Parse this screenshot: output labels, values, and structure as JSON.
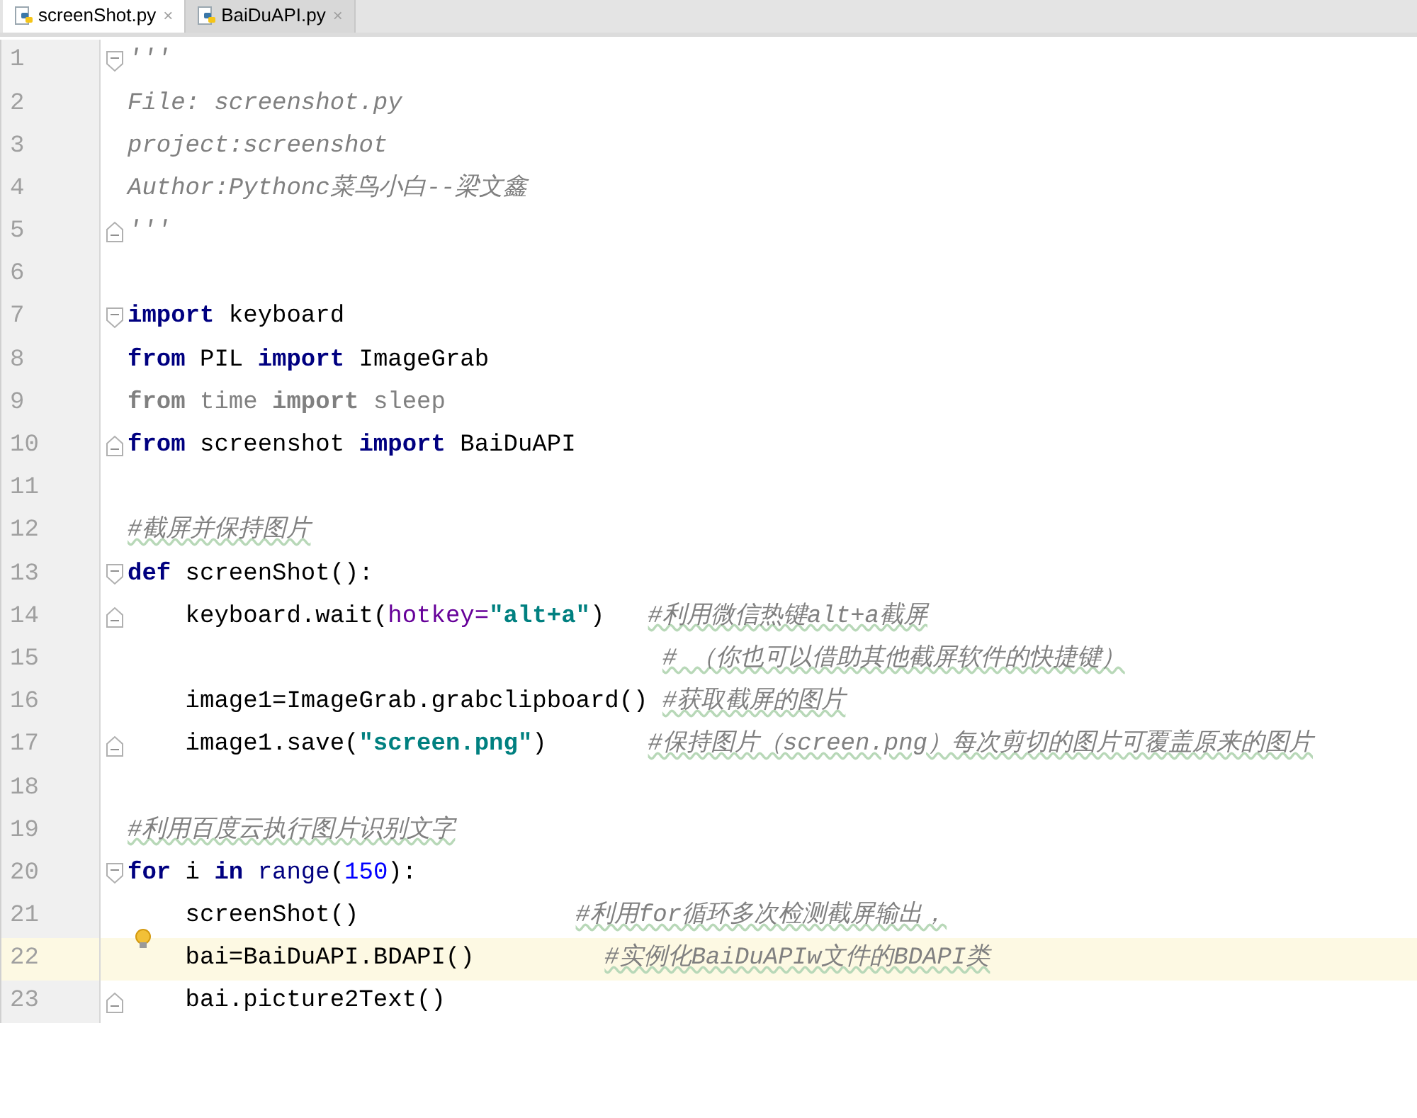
{
  "tabs": [
    {
      "label": "screenShot.py",
      "close": "×",
      "selected": true
    },
    {
      "label": "BaiDuAPI.py",
      "close": "×",
      "selected": false
    }
  ],
  "lines": [
    {
      "number": "1",
      "fold_start": true,
      "fold_end": false,
      "current": false,
      "tokens": [
        {
          "kind": "docstring",
          "text": "'''"
        }
      ]
    },
    {
      "number": "2",
      "fold_start": false,
      "fold_end": false,
      "current": false,
      "tokens": [
        {
          "kind": "docstring",
          "text": "File: screenshot.py"
        }
      ]
    },
    {
      "number": "3",
      "fold_start": false,
      "fold_end": false,
      "current": false,
      "tokens": [
        {
          "kind": "docstring",
          "text": "project:screenshot"
        }
      ]
    },
    {
      "number": "4",
      "fold_start": false,
      "fold_end": false,
      "current": false,
      "tokens": [
        {
          "kind": "docstring",
          "text": "Author:Pythonc菜鸟小白--梁文鑫"
        }
      ]
    },
    {
      "number": "5",
      "fold_start": false,
      "fold_end": true,
      "current": false,
      "tokens": [
        {
          "kind": "docstring",
          "text": "'''"
        }
      ]
    },
    {
      "number": "6",
      "fold_start": false,
      "fold_end": false,
      "current": false
    },
    {
      "number": "7",
      "fold_start": true,
      "fold_end": false,
      "current": false,
      "tokens": [
        {
          "kind": "keyword",
          "text": "import"
        },
        {
          "kind": "plain",
          "text": " keyboard"
        }
      ]
    },
    {
      "number": "8",
      "fold_start": false,
      "fold_end": false,
      "current": false,
      "tokens": [
        {
          "kind": "keyword",
          "text": "from"
        },
        {
          "kind": "plain",
          "text": " PIL "
        },
        {
          "kind": "keyword",
          "text": "import"
        },
        {
          "kind": "plain",
          "text": " ImageGrab"
        }
      ]
    },
    {
      "number": "9",
      "fold_start": false,
      "fold_end": false,
      "current": false,
      "tokens": [
        {
          "kind": "unused_keyword",
          "text": "from"
        },
        {
          "kind": "unused",
          "text": " time "
        },
        {
          "kind": "unused_keyword",
          "text": "import"
        },
        {
          "kind": "unused",
          "text": " sleep"
        }
      ]
    },
    {
      "number": "10",
      "fold_start": false,
      "fold_end": true,
      "current": false,
      "tokens": [
        {
          "kind": "keyword",
          "text": "from"
        },
        {
          "kind": "plain",
          "text": " screenshot "
        },
        {
          "kind": "keyword",
          "text": "import"
        },
        {
          "kind": "plain",
          "text": " BaiDuAPI"
        }
      ]
    },
    {
      "number": "11",
      "fold_start": false,
      "fold_end": false,
      "current": false
    },
    {
      "number": "12",
      "fold_start": false,
      "fold_end": false,
      "current": false,
      "tokens": [
        {
          "kind": "comment",
          "text": "#截屏并保持图片"
        }
      ]
    },
    {
      "number": "13",
      "fold_start": true,
      "fold_end": false,
      "current": false,
      "tokens": [
        {
          "kind": "keyword",
          "text": "def"
        },
        {
          "kind": "plain",
          "text": " screenShot():"
        }
      ]
    },
    {
      "number": "14",
      "fold_start": false,
      "fold_end": true,
      "current": false,
      "tokens": [
        {
          "kind": "plain",
          "text": "    keyboard.wait("
        },
        {
          "kind": "param",
          "text": "hotkey="
        },
        {
          "kind": "string",
          "text": "\"alt+a\""
        },
        {
          "kind": "plain",
          "text": ")   "
        },
        {
          "kind": "comment",
          "text": "#利用微信热键alt+a截屏"
        }
      ]
    },
    {
      "number": "15",
      "fold_start": false,
      "fold_end": false,
      "current": false,
      "tokens": [
        {
          "kind": "continued_comment",
          "text": "# （你也可以借助其他截屏软件的快捷键）"
        }
      ]
    },
    {
      "number": "16",
      "fold_start": false,
      "fold_end": false,
      "current": false,
      "tokens": [
        {
          "kind": "plain",
          "text": "    image1=ImageGrab.grabclipboard() "
        },
        {
          "kind": "comment",
          "text": "#获取截屏的图片"
        }
      ]
    },
    {
      "number": "17",
      "fold_start": false,
      "fold_end": true,
      "current": false,
      "tokens": [
        {
          "kind": "plain",
          "text": "    image1.save("
        },
        {
          "kind": "string",
          "text": "\"screen.png\""
        },
        {
          "kind": "plain",
          "text": ")       "
        },
        {
          "kind": "comment",
          "text": "#保持图片（screen.png）每次剪切的图片可覆盖原来的图片"
        }
      ]
    },
    {
      "number": "18",
      "fold_start": false,
      "fold_end": false,
      "current": false
    },
    {
      "number": "19",
      "fold_start": false,
      "fold_end": false,
      "current": false,
      "tokens": [
        {
          "kind": "comment",
          "text": "#利用百度云执行图片识别文字"
        }
      ]
    },
    {
      "number": "20",
      "fold_start": true,
      "fold_end": false,
      "current": false,
      "tokens": [
        {
          "kind": "keyword",
          "text": "for"
        },
        {
          "kind": "plain",
          "text": " i "
        },
        {
          "kind": "keyword",
          "text": "in"
        },
        {
          "kind": "builtin",
          "text": " range"
        },
        {
          "kind": "plain",
          "text": "("
        },
        {
          "kind": "number",
          "text": "150"
        },
        {
          "kind": "plain",
          "text": "):"
        }
      ]
    },
    {
      "number": "21",
      "fold_start": false,
      "fold_end": false,
      "current": false,
      "tokens": [
        {
          "kind": "plain",
          "text": "    screenShot()               "
        },
        {
          "kind": "comment",
          "text": "#利用for循环多次检测截屏输出，"
        }
      ]
    },
    {
      "number": "22",
      "fold_start": false,
      "fold_end": false,
      "current": true,
      "tokens": [
        {
          "kind": "plain",
          "text": "    bai=BaiDuAPI.BDAPI()         "
        },
        {
          "kind": "comment",
          "text": "#实例化BaiDuAPIw文件的BDAPI类"
        }
      ]
    },
    {
      "number": "23",
      "fold_start": false,
      "fold_end": true,
      "current": false,
      "tokens": [
        {
          "kind": "plain",
          "text": "    bai.picture2Text()"
        }
      ]
    }
  ]
}
